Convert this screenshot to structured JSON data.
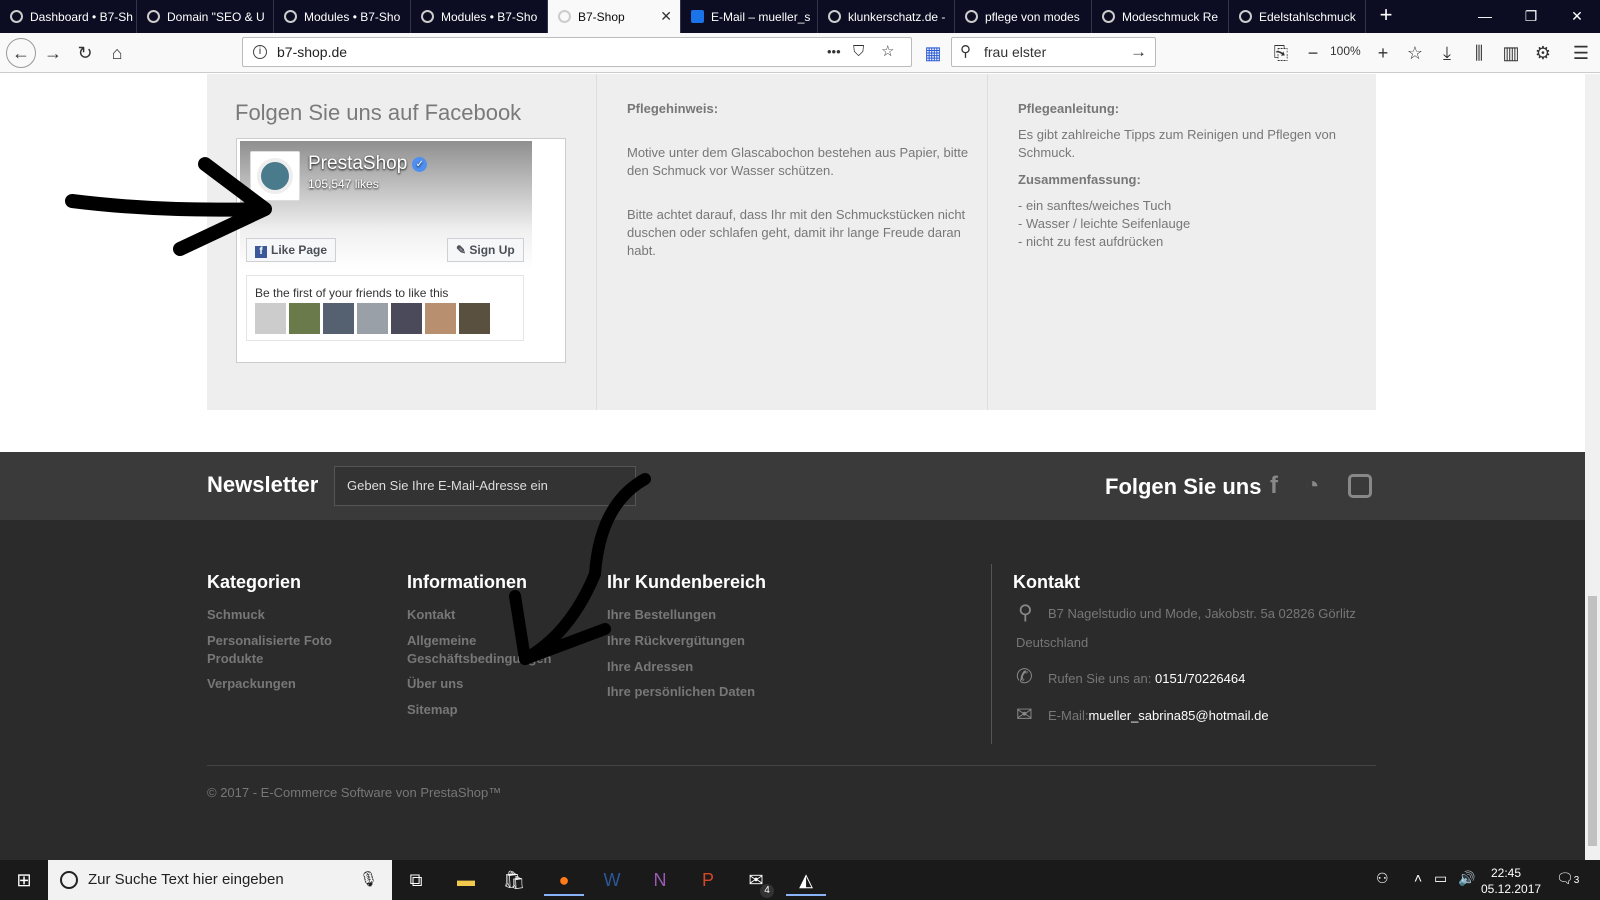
{
  "browser": {
    "tabs": [
      {
        "label": "Dashboard • B7-Sh",
        "icon": "prestashop-icon"
      },
      {
        "label": "Domain \"SEO & U",
        "icon": "prestashop-icon"
      },
      {
        "label": "Modules • B7-Sho",
        "icon": "prestashop-icon"
      },
      {
        "label": "Modules • B7-Sho",
        "icon": "prestashop-icon"
      },
      {
        "label": "B7-Shop",
        "icon": "prestashop-icon",
        "active": true
      },
      {
        "label": "E-Mail – mueller_s",
        "icon": "outlook-icon"
      },
      {
        "label": "klunkerschatz.de -",
        "icon": "site-icon"
      },
      {
        "label": "pflege von modes",
        "icon": "google-icon"
      },
      {
        "label": "Modeschmuck Re",
        "icon": "site-icon"
      },
      {
        "label": "Edelstahlschmuck",
        "icon": "site-icon"
      }
    ],
    "url": "b7-shop.de",
    "search_value": "frau elster",
    "zoom": "100%",
    "url_more": "•••"
  },
  "facebook": {
    "title": "Folgen Sie uns auf Facebook",
    "page_name": "PrestaShop",
    "likes": "105,547 likes",
    "like_button": "Like Page",
    "signup_button": "Sign Up",
    "friends_text": "Be the first of your friends to like this"
  },
  "care_col1": {
    "title": "Pflegehinweis:",
    "p1": "Motive unter dem Glascabochon bestehen aus Papier, bitte den Schmuck vor Wasser schützen.",
    "p2": "Bitte achtet darauf, dass Ihr mit den Schmuckstücken nicht duschen oder schlafen geht, damit ihr lange Freude daran habt."
  },
  "care_col2": {
    "title": "Pflegeanleitung:",
    "p1": "Es gibt zahlreiche Tipps zum Reinigen und Pflegen von Schmuck.",
    "title2": "Zusammenfassung:",
    "items": [
      "- ein sanftes/weiches Tuch",
      "- Wasser / leichte Seifenlauge",
      "- nicht zu fest aufdrücken"
    ]
  },
  "newsletter": {
    "title": "Newsletter",
    "placeholder": "Geben Sie Ihre E-Mail-Adresse ein",
    "follow": "Folgen Sie uns"
  },
  "footer": {
    "kategorien": {
      "title": "Kategorien",
      "links": [
        "Schmuck",
        "Personalisierte Foto Produkte",
        "Verpackungen"
      ]
    },
    "informationen": {
      "title": "Informationen",
      "links": [
        "Kontakt",
        "Allgemeine Geschäftsbedingungen",
        "Über uns",
        "Sitemap"
      ]
    },
    "kundenbereich": {
      "title": "Ihr Kundenbereich",
      "links": [
        "Ihre Bestellungen",
        "Ihre Rückvergütungen",
        "Ihre Adressen",
        "Ihre persönlichen Daten"
      ]
    },
    "kontakt": {
      "title": "Kontakt",
      "address": "B7 Nagelstudio und Mode, Jakobstr. 5a 02826 Görlitz",
      "country": "Deutschland",
      "phone_label": "Rufen Sie uns an:",
      "phone": "0151/70226464",
      "email_label": "E-Mail:",
      "email": "mueller_sabrina85@hotmail.de"
    },
    "copyright": "© 2017 - E-Commerce Software von PrestaShop™"
  },
  "taskbar": {
    "search_placeholder": "Zur Suche Text hier eingeben",
    "time": "22:45",
    "date": "05.12.2017",
    "mail_badge": "4",
    "notif_badge": "3"
  }
}
